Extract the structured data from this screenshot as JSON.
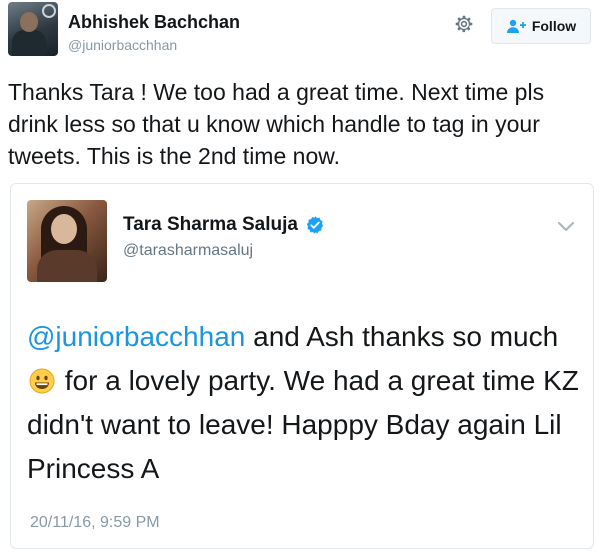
{
  "outer_tweet": {
    "author_name": "Abhishek Bachchan",
    "author_handle": "@juniorbacchhan",
    "follow_label": "Follow",
    "text": "Thanks Tara ! We too had a great time. Next time pls drink less so that u know which handle to tag in your tweets. This is the 2nd time now."
  },
  "quoted_tweet": {
    "author_name": "Tara Sharma Saluja",
    "author_handle": "@tarasharmasaluj",
    "verified": true,
    "mention": "@juniorbacchhan",
    "text_part1": " and Ash thanks so much",
    "emoji": "grinning-face",
    "text_part2": " for a lovely party. We had a great time KZ didn't want to leave! Happpy Bday again Lil Princess A",
    "timestamp": "20/11/16, 9:59 PM"
  },
  "colors": {
    "link": "#1b95e0",
    "verified_badge": "#1da1f2",
    "secondary_text": "#8899a6"
  }
}
